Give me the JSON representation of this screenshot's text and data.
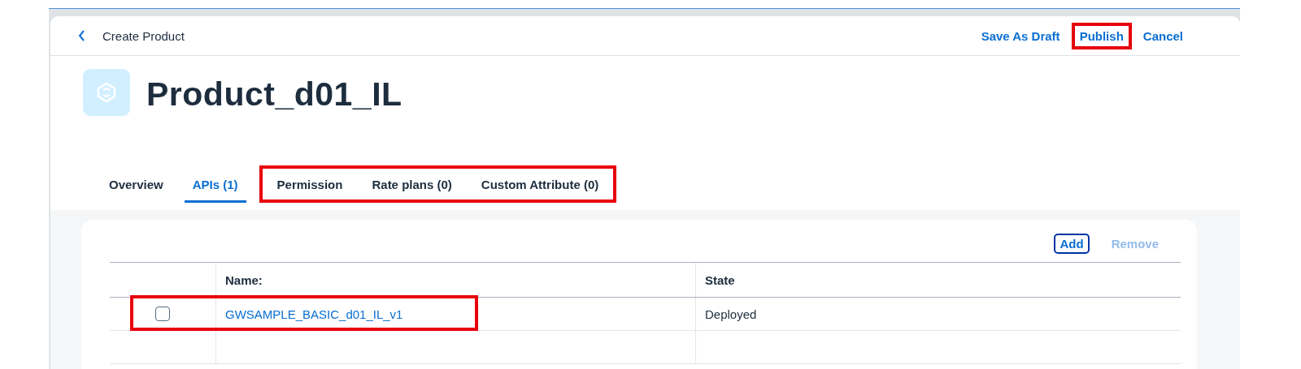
{
  "header": {
    "back_label": "Create Product",
    "actions": [
      {
        "label": "Save As Draft",
        "highlighted": false
      },
      {
        "label": "Publish",
        "highlighted": true
      },
      {
        "label": "Cancel",
        "highlighted": false
      }
    ]
  },
  "object": {
    "title": "Product_d01_IL"
  },
  "tabs": [
    {
      "label": "Overview",
      "selected": false,
      "highlighted": false
    },
    {
      "label": "APIs (1)",
      "selected": true,
      "highlighted": false
    },
    {
      "label": "Permission",
      "selected": false,
      "highlighted": true
    },
    {
      "label": "Rate plans (0)",
      "selected": false,
      "highlighted": true
    },
    {
      "label": "Custom Attribute (0)",
      "selected": false,
      "highlighted": true
    }
  ],
  "table": {
    "toolbar": [
      {
        "label": "Add",
        "disabled": false,
        "focused": true
      },
      {
        "label": "Remove",
        "disabled": true,
        "focused": false
      }
    ],
    "columns": [
      "Name:",
      "State"
    ],
    "rows": [
      {
        "checked": false,
        "name": "GWSAMPLE_BASIC_d01_IL_v1",
        "state": "Deployed",
        "highlighted": true
      }
    ]
  }
}
